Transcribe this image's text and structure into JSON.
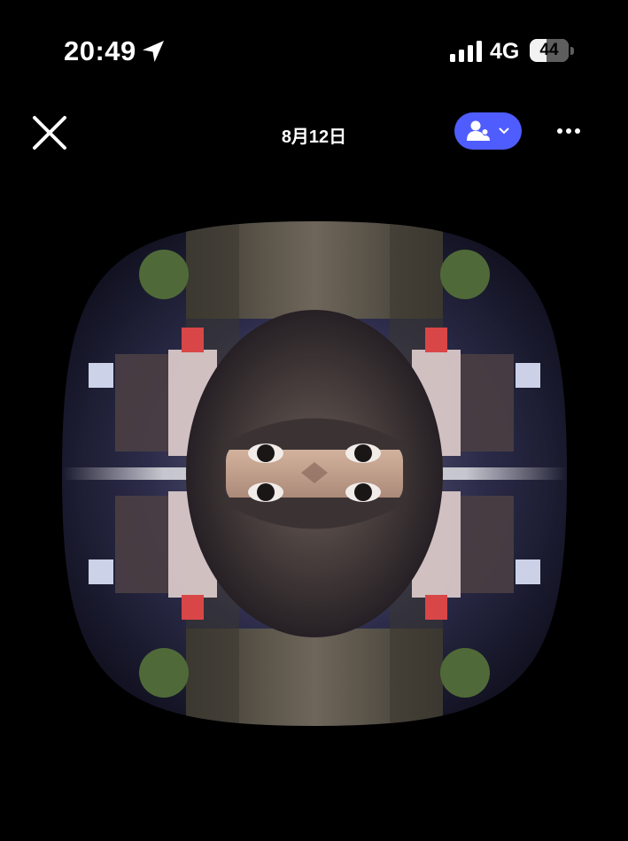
{
  "status_bar": {
    "time": "20:49",
    "location_icon": "location-arrow-icon",
    "signal_icon": "cellular-signal-icon",
    "network": "4G",
    "battery_level": "44",
    "battery_percent": 44
  },
  "nav": {
    "close_icon": "close-icon",
    "title": "8月12日",
    "share_icon": "people-icon",
    "share_chevron_icon": "chevron-down-icon",
    "share_color": "#4f5dff",
    "more_icon": "more-horizontal-icon"
  },
  "photo": {
    "shape": "squircle",
    "subject": "kaleidoscope-mirrored-selfie"
  }
}
